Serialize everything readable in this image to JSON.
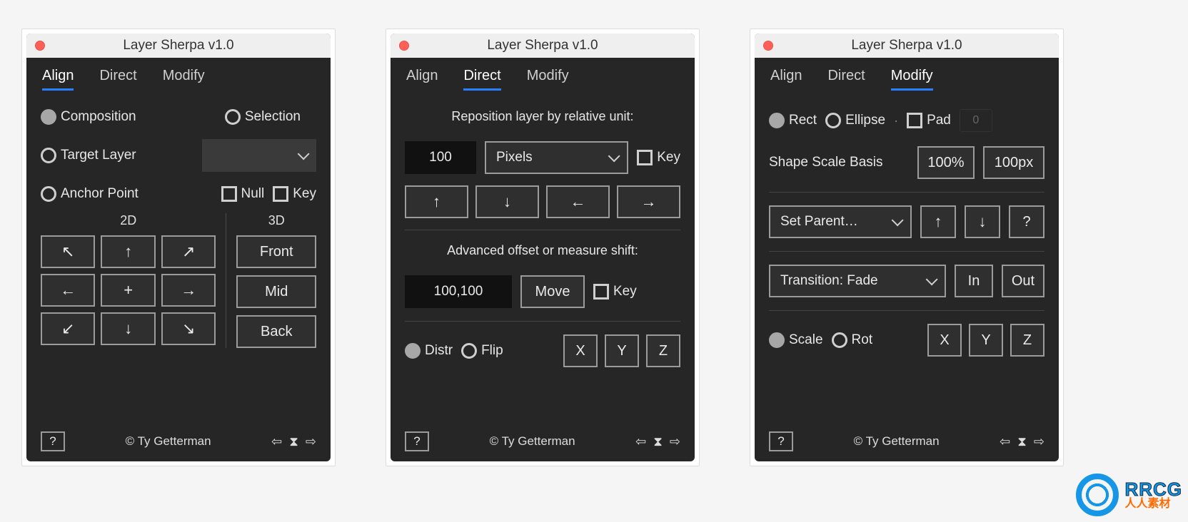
{
  "title": "Layer Sherpa v1.0",
  "credit": "© Ty Getterman",
  "tabs": {
    "align": "Align",
    "direct": "Direct",
    "modify": "Modify"
  },
  "footer_help": "?",
  "arrows": {
    "nw": "↖",
    "n": "↑",
    "ne": "↗",
    "w": "←",
    "c": "+",
    "e": "→",
    "sw": "↙",
    "s": "↓",
    "se": "↘",
    "hourglass": "⌛",
    "back": "⇦",
    "fwd": "⇨"
  },
  "align": {
    "radios": {
      "composition": "Composition",
      "selection": "Selection",
      "target_layer": "Target Layer",
      "anchor_point": "Anchor Point"
    },
    "checks": {
      "null": "Null",
      "key": "Key"
    },
    "head2d": "2D",
    "head3d": "3D",
    "front": "Front",
    "mid": "Mid",
    "back": "Back"
  },
  "direct": {
    "section1": "Reposition layer by relative unit:",
    "amount": "100",
    "unit": "Pixels",
    "key": "Key",
    "section2": "Advanced offset or measure shift:",
    "offset": "100,100",
    "move": "Move",
    "distr": "Distr",
    "flip": "Flip",
    "x": "X",
    "y": "Y",
    "z": "Z"
  },
  "modify": {
    "rect": "Rect",
    "ellipse": "Ellipse",
    "pad": "Pad",
    "pad_value": "0",
    "scale_basis_label": "Shape Scale Basis",
    "scale_pct": "100%",
    "scale_px": "100px",
    "set_parent": "Set Parent…",
    "q": "?",
    "transition": "Transition: Fade",
    "in": "In",
    "out": "Out",
    "scale": "Scale",
    "rot": "Rot",
    "x": "X",
    "y": "Y",
    "z": "Z"
  },
  "watermark": {
    "line1": "RRCG",
    "line2": "人人素材"
  }
}
